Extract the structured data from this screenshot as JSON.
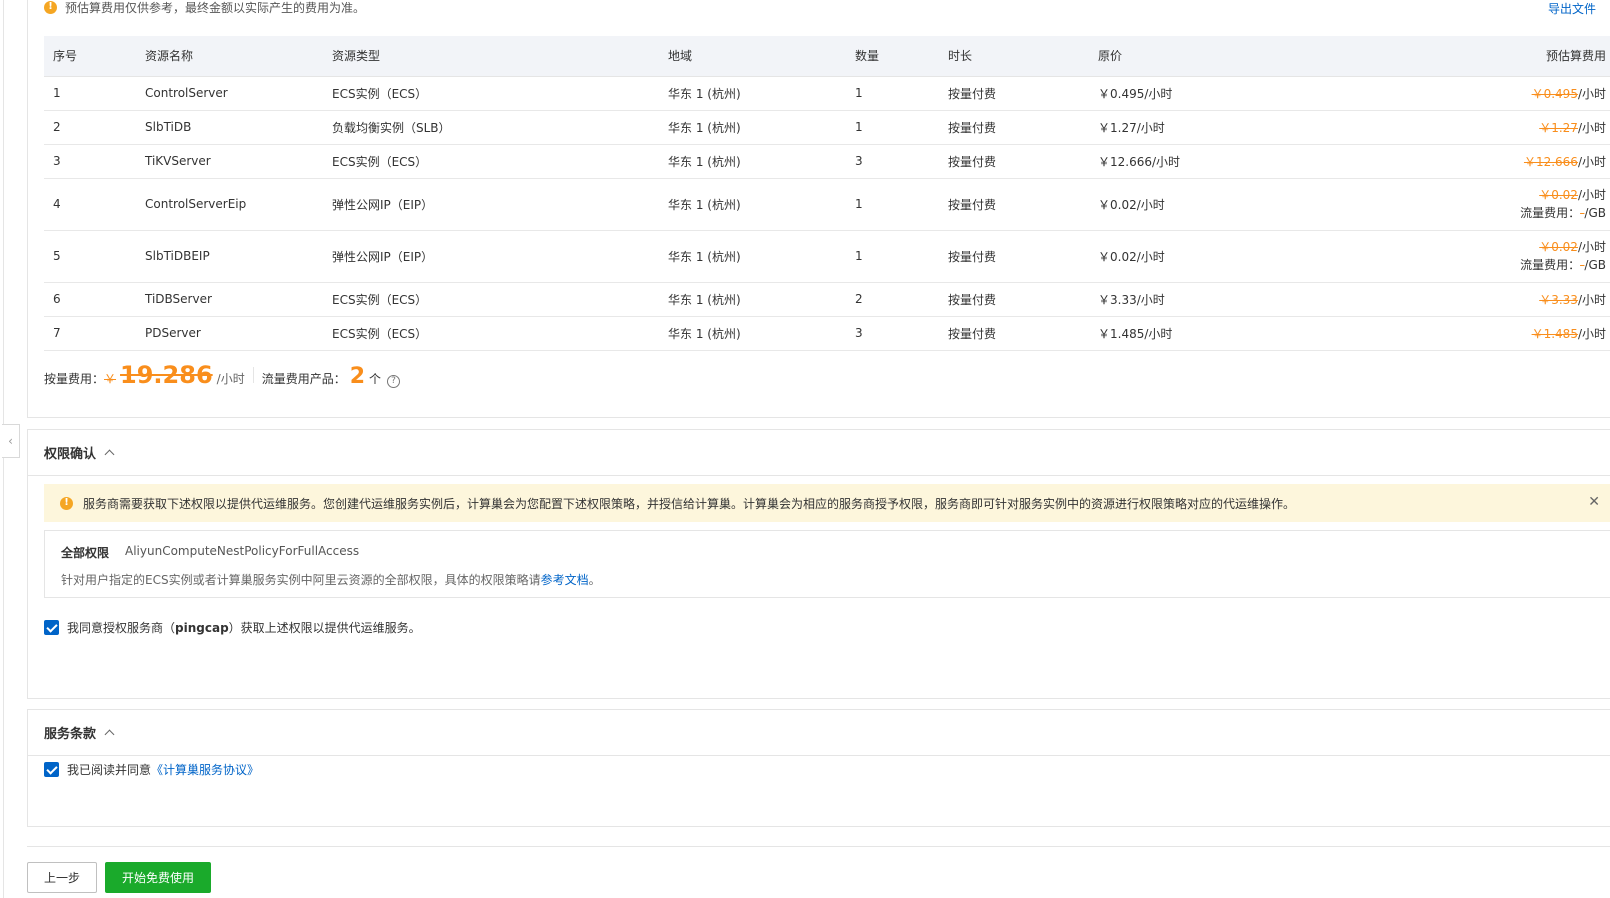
{
  "notice": {
    "text": "预估算费用仅供参考，最终金额以实际产生的费用为准。",
    "export_label": "导出文件"
  },
  "table": {
    "headers": [
      "序号",
      "资源名称",
      "资源类型",
      "地域",
      "数量",
      "时长",
      "原价",
      "预估算费用"
    ],
    "rows": [
      {
        "no": "1",
        "name": "ControlServer",
        "type": "ECS实例（ECS）",
        "region": "华东 1 (杭州)",
        "qty": "1",
        "duration": "按量付费",
        "price": "￥0.495/小时",
        "est": "￥0.495",
        "est_unit": "/小时",
        "flow": ""
      },
      {
        "no": "2",
        "name": "SlbTiDB",
        "type": "负载均衡实例（SLB）",
        "region": "华东 1 (杭州)",
        "qty": "1",
        "duration": "按量付费",
        "price": "￥1.27/小时",
        "est": "￥1.27",
        "est_unit": "/小时",
        "flow": ""
      },
      {
        "no": "3",
        "name": "TiKVServer",
        "type": "ECS实例（ECS）",
        "region": "华东 1 (杭州)",
        "qty": "3",
        "duration": "按量付费",
        "price": "￥12.666/小时",
        "est": "￥12.666",
        "est_unit": "/小时",
        "flow": ""
      },
      {
        "no": "4",
        "name": "ControlServerEip",
        "type": "弹性公网IP（EIP）",
        "region": "华东 1 (杭州)",
        "qty": "1",
        "duration": "按量付费",
        "price": "￥0.02/小时",
        "est": "￥0.02",
        "est_unit": "/小时",
        "flow_label": "流量费用：",
        "flow_value": "-",
        "flow_unit": "/GB"
      },
      {
        "no": "5",
        "name": "SlbTiDBEIP",
        "type": "弹性公网IP（EIP）",
        "region": "华东 1 (杭州)",
        "qty": "1",
        "duration": "按量付费",
        "price": "￥0.02/小时",
        "est": "￥0.02",
        "est_unit": "/小时",
        "flow_label": "流量费用：",
        "flow_value": "-",
        "flow_unit": "/GB"
      },
      {
        "no": "6",
        "name": "TiDBServer",
        "type": "ECS实例（ECS）",
        "region": "华东 1 (杭州)",
        "qty": "2",
        "duration": "按量付费",
        "price": "￥3.33/小时",
        "est": "￥3.33",
        "est_unit": "/小时",
        "flow": ""
      },
      {
        "no": "7",
        "name": "PDServer",
        "type": "ECS实例（ECS）",
        "region": "华东 1 (杭州)",
        "qty": "3",
        "duration": "按量付费",
        "price": "￥1.485/小时",
        "est": "￥1.485",
        "est_unit": "/小时",
        "flow": ""
      }
    ]
  },
  "summary": {
    "label": "按量费用：",
    "yen": "￥",
    "total": "19.286",
    "unit": "/小时",
    "flow_label": "流量费用产品：",
    "flow_count": "2",
    "flow_unit": "个"
  },
  "permission": {
    "title": "权限确认",
    "alert": "服务商需要获取下述权限以提供代运维服务。您创建代运维服务实例后，计算巢会为您配置下述权限策略，并授信给计算巢。计算巢会为相应的服务商授予权限，服务商即可针对服务实例中的资源进行权限策略对应的代运维操作。",
    "label": "全部权限",
    "policy": "AliyunComputeNestPolicyForFullAccess",
    "desc": "针对用户指定的ECS实例或者计算巢服务实例中阿里云资源的全部权限，具体的权限策略请",
    "doc_link": "参考文档",
    "desc_end": "。",
    "agree_pre": "我同意授权服务商（",
    "agree_vendor": "pingcap",
    "agree_post": "）获取上述权限以提供代运维服务。"
  },
  "terms": {
    "title": "服务条款",
    "agree_pre": "我已阅读并同意",
    "agree_link": "《计算巢服务协议》"
  },
  "buttons": {
    "prev": "上一步",
    "start": "开始免费使用"
  },
  "colors": {
    "accent": "#0064c8",
    "strike": "#f98e1c",
    "primary_green": "#1aaa2b",
    "alert_bg": "#fdf6dc"
  }
}
